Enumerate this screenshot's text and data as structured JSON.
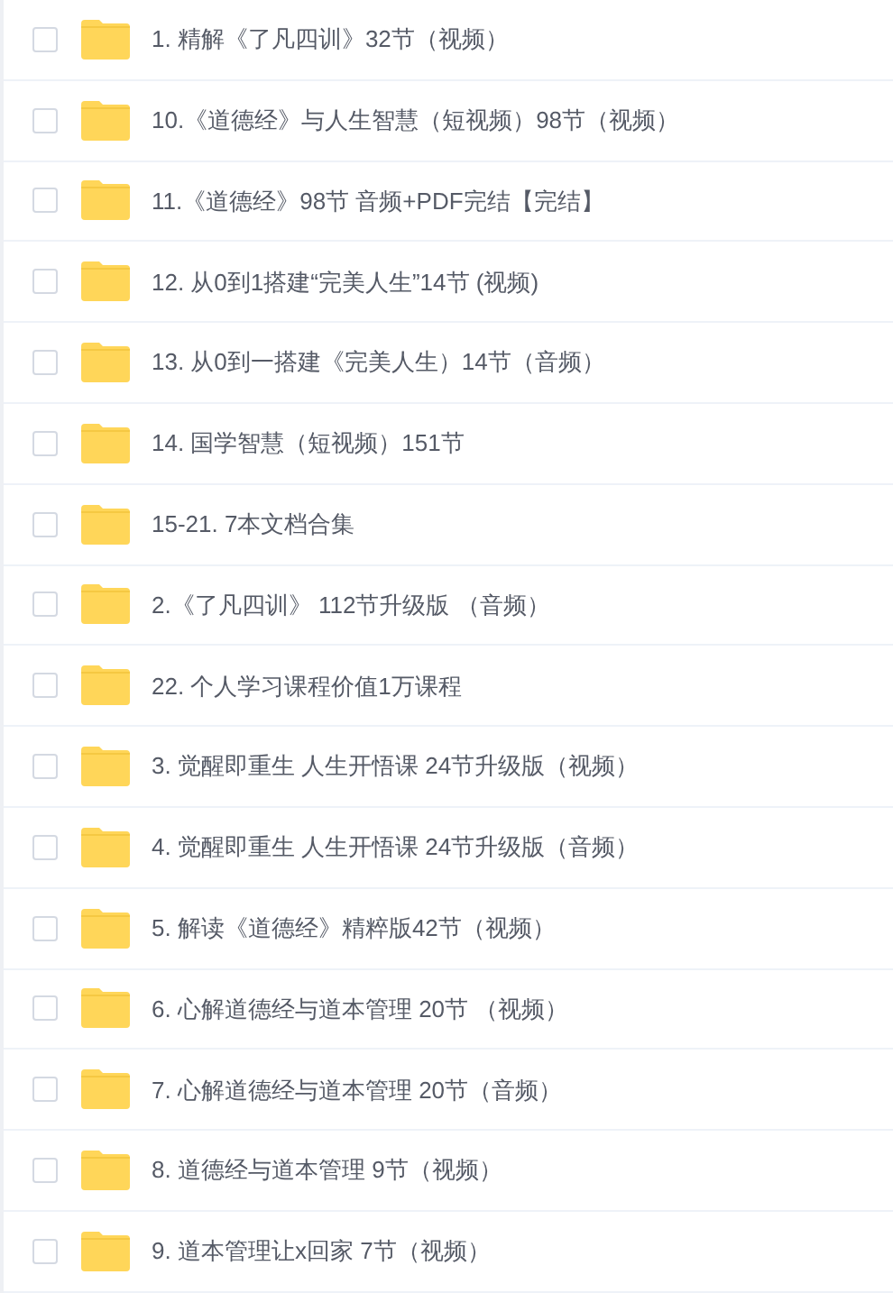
{
  "files": [
    {
      "name": "1. 精解《了凡四训》32节（视频）",
      "checked": false
    },
    {
      "name": "10.《道德经》与人生智慧（短视频）98节（视频）",
      "checked": false
    },
    {
      "name": "11.《道德经》98节 音频+PDF完结【完结】",
      "checked": false
    },
    {
      "name": "12. 从0到1搭建“完美人生”14节 (视频)",
      "checked": false
    },
    {
      "name": "13. 从0到一搭建《完美人生）14节（音频）",
      "checked": false
    },
    {
      "name": "14. 国学智慧（短视频）151节",
      "checked": false
    },
    {
      "name": "15-21. 7本文档合集",
      "checked": false
    },
    {
      "name": "2.《了凡四训》 112节升级版 （音频）",
      "checked": false
    },
    {
      "name": "22. 个人学习课程价值1万课程",
      "checked": false
    },
    {
      "name": "3. 觉醒即重生 人生开悟课 24节升级版（视频）",
      "checked": false
    },
    {
      "name": "4. 觉醒即重生 人生开悟课 24节升级版（音频）",
      "checked": false
    },
    {
      "name": "5. 解读《道德经》精粹版42节（视频）",
      "checked": false
    },
    {
      "name": "6. 心解道德经与道本管理 20节 （视频）",
      "checked": false
    },
    {
      "name": "7. 心解道德经与道本管理 20节（音频）",
      "checked": false
    },
    {
      "name": "8. 道德经与道本管理 9节（视频）",
      "checked": false
    },
    {
      "name": "9. 道本管理让x回家 7节（视频）",
      "checked": false
    }
  ]
}
